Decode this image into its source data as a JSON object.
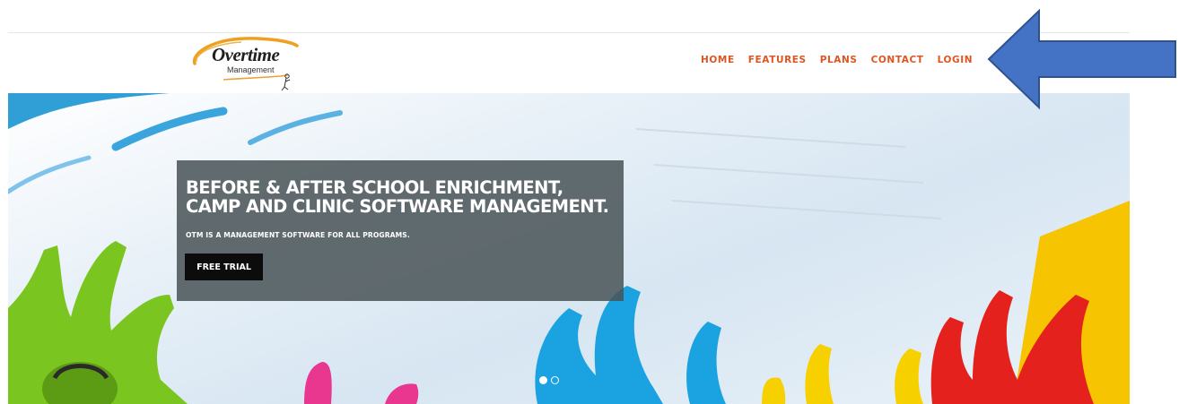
{
  "header": {
    "logo": {
      "word": "Overtime",
      "sub": "Management"
    },
    "nav": [
      "HOME",
      "FEATURES",
      "PLANS",
      "CONTACT",
      "LOGIN"
    ]
  },
  "hero": {
    "headline_line1": "BEFORE & AFTER SCHOOL ENRICHMENT,",
    "headline_line2": "CAMP AND CLINIC SOFTWARE MANAGEMENT.",
    "subline": "OTM IS A MANAGEMENT SOFTWARE FOR ALL PROGRAMS.",
    "cta": "FREE TRIAL",
    "slides": 2,
    "active_slide": 1
  },
  "annotation": {
    "arrow_color": "#4472c4",
    "points_to": "LOGIN"
  },
  "colors": {
    "nav": "#e0551f",
    "overlay": "#485256",
    "button": "#0c0c0c"
  }
}
